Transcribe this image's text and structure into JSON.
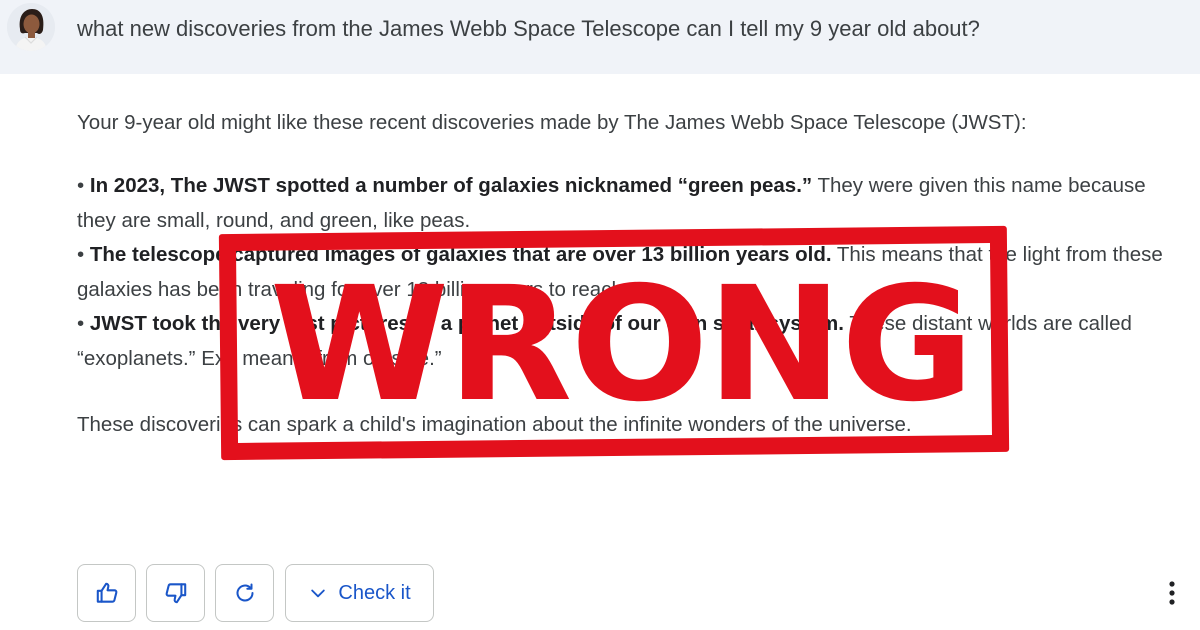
{
  "prompt": {
    "text": "what new discoveries from the James Webb Space Telescope can I tell my 9 year old about?"
  },
  "response": {
    "intro": "Your 9-year old might like these recent discoveries made by The James Webb Space Telescope (JWST):",
    "bullets": [
      {
        "marker": "•",
        "bold": "In 2023, The JWST spotted a number of galaxies nicknamed “green peas.”",
        "text": "They were given this name because they are small, round, and green, like peas."
      },
      {
        "marker": "•",
        "bold": "The telescope captured images of galaxies that are over 13 billion years old.",
        "text": "This means that the light from these galaxies has been traveling for over 13 billion years to reach us."
      },
      {
        "marker": "•",
        "bold": "JWST took the very first pictures of a planet outside of our own solar system.",
        "text": "These distant worlds are called “exoplanets.” Exo means “from outside.”"
      }
    ],
    "closing": "These discoveries can spark a child's imagination about the infinite wonders of the universe."
  },
  "stamp": {
    "text": "WRONG",
    "color": "#e3101c"
  },
  "actions": {
    "thumbs_up_icon": "thumbs-up-icon",
    "thumbs_down_icon": "thumbs-down-icon",
    "regenerate_icon": "refresh-icon",
    "check_label": "Check it",
    "check_icon": "chevron-down-icon",
    "more_icon": "more-vert-icon"
  },
  "colors": {
    "prompt_bar": "#f0f3f8",
    "text": "#3c4043",
    "accent": "#1a56c9",
    "stamp": "#e3101c"
  }
}
